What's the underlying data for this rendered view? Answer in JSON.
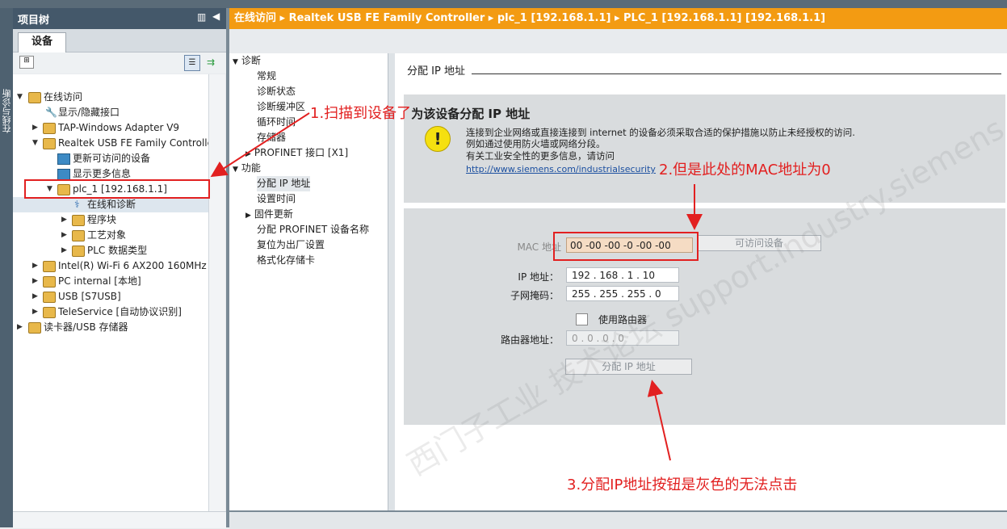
{
  "vertical_tab": {
    "label": "在线与诊断"
  },
  "tree": {
    "title": "项目树",
    "tab": "设备",
    "items": [
      {
        "label": "在线访问",
        "level": 0,
        "expanded": true
      },
      {
        "label": "显示/隐藏接口",
        "level": 1
      },
      {
        "label": "TAP-Windows Adapter V9",
        "level": 1,
        "expanded": false
      },
      {
        "label": "Realtek USB FE Family Controller",
        "level": 1,
        "expanded": true
      },
      {
        "label": "更新可访问的设备",
        "level": 2
      },
      {
        "label": "显示更多信息",
        "level": 2
      },
      {
        "label": "plc_1 [192.168.1.1]",
        "level": 2,
        "expanded": true
      },
      {
        "label": "在线和诊断",
        "level": 3
      },
      {
        "label": "程序块",
        "level": 3,
        "expanded": false
      },
      {
        "label": "工艺对象",
        "level": 3,
        "expanded": false
      },
      {
        "label": "PLC 数据类型",
        "level": 3,
        "expanded": false
      },
      {
        "label": "Intel(R) Wi-Fi 6 AX200 160MHz",
        "level": 1,
        "expanded": false
      },
      {
        "label": "PC internal [本地]",
        "level": 1,
        "expanded": false
      },
      {
        "label": "USB [S7USB]",
        "level": 1,
        "expanded": false
      },
      {
        "label": "TeleService [自动协议识别]",
        "level": 1,
        "expanded": false
      },
      {
        "label": "读卡器/USB 存储器",
        "level": 0,
        "expanded": false
      }
    ]
  },
  "breadcrumb": {
    "text": "在线访问  ▸  Realtek USB FE Family Controller  ▸  plc_1 [192.168.1.1]  ▸  PLC_1 [192.168.1.1] [192.168.1.1]"
  },
  "nav": {
    "diag_header": "诊断",
    "diag_items": [
      "常规",
      "诊断状态",
      "诊断缓冲区",
      "循环时间",
      "存储器",
      "PROFINET 接口 [X1]"
    ],
    "func_header": "功能",
    "func_items": [
      "分配 IP 地址",
      "设置时间",
      "固件更新",
      "分配 PROFINET 设备名称",
      "复位为出厂设置",
      "格式化存储卡"
    ]
  },
  "main": {
    "section_title": "分配 IP 地址",
    "heading_prefix": "1.扫描到设备了",
    "heading": "为该设备分配 IP 地址",
    "warning": {
      "line1": "连接到企业网络或直接连接到 internet 的设备必须采取合适的保护措施以防止未经授权的访问.",
      "line2": "例如通过使用防火墙或网络分段。",
      "line3": "有关工业安全性的更多信息，请访问",
      "link": "http://www.siemens.com/industrialsecurity"
    },
    "mac_label": "MAC 地址",
    "mac_value": "00 -00 -00 -0   -00 -00",
    "accessible_devices_button": "可访问设备",
    "ip_label": "IP 地址：",
    "ip_value": "192 . 168 . 1    . 10",
    "subnet_label": "子网掩码：",
    "subnet_value": "255 . 255 . 255 . 0",
    "use_router_label": "使用路由器",
    "router_label": "路由器地址：",
    "router_value": "0    . 0    . 0    . 0",
    "assign_button": "分配 IP 地址"
  },
  "annotations": {
    "a2": "2.但是此处的MAC地址为0",
    "a3": "3.分配IP地址按钮是灰色的无法点击"
  },
  "watermark": "西门子工业 技术论坛 support.industry.siemens.com/cs",
  "colors": {
    "accent": "#f39b12",
    "annotation": "#e22020",
    "panel": "#d9dcde"
  }
}
